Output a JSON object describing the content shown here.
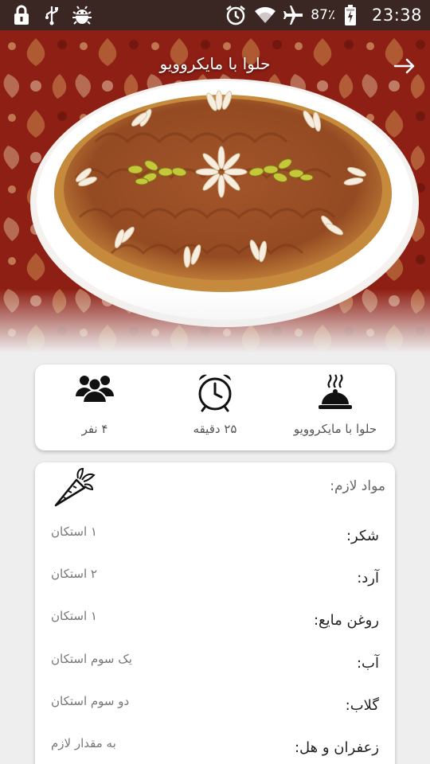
{
  "status_bar": {
    "battery_percent": "87٪",
    "time": "23:38"
  },
  "header": {
    "title": "حلوا با مایکروویو"
  },
  "info": {
    "dish_label": "حلوا با مایکروویو",
    "time_label": "۲۵ دقیقه",
    "servings_label": "۴ نفر"
  },
  "ingredients": {
    "title": "مواد لازم:",
    "items": [
      {
        "name": "شکر:",
        "amount": "۱ استکان"
      },
      {
        "name": "آرد:",
        "amount": "۲ استکان"
      },
      {
        "name": "روغن مایع:",
        "amount": "۱ استکان"
      },
      {
        "name": "آب:",
        "amount": "یک سوم استکان"
      },
      {
        "name": "گلاب:",
        "amount": "دو سوم استکان"
      },
      {
        "name": "زعفران و هل:",
        "amount": "به مقدار لازم"
      }
    ]
  },
  "colors": {
    "status_bar": "#3a2622",
    "background": "#eeeeee",
    "card": "#ffffff",
    "halva": "#a8602a"
  }
}
